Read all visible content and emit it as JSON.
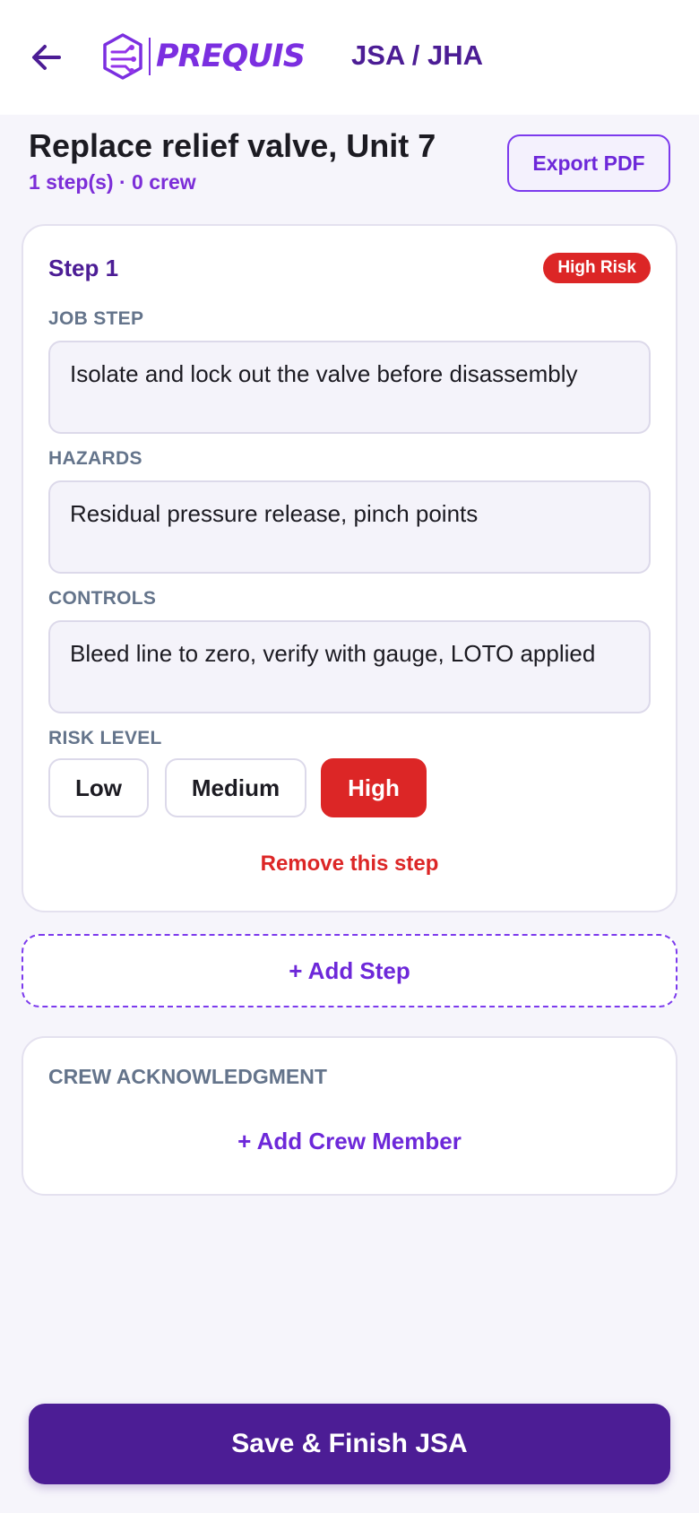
{
  "header": {
    "logo_text": "PREQUIS",
    "title": "JSA / JHA",
    "back_icon": "arrow-left-icon",
    "logo_icon": "prequis-hex-logo-icon"
  },
  "jsa": {
    "title": "Replace relief valve, Unit 7",
    "summary": "1 step(s) · 0 crew",
    "export_label": "Export PDF"
  },
  "steps": [
    {
      "label": "Step 1",
      "risk_badge": "High Risk",
      "job_step_label": "JOB STEP",
      "job_step_value": "Isolate and lock out the valve before disassembly",
      "hazards_label": "HAZARDS",
      "hazards_value": "Residual pressure release, pinch points",
      "controls_label": "CONTROLS",
      "controls_value": "Bleed line to zero, verify with gauge, LOTO applied",
      "risk_level_label": "RISK LEVEL",
      "risk_options": [
        "Low",
        "Medium",
        "High"
      ],
      "risk_selected": "High",
      "remove_label": "Remove this step"
    }
  ],
  "add_step_label": "+ Add Step",
  "crew": {
    "title": "CREW ACKNOWLEDGMENT",
    "add_label": "+ Add Crew Member"
  },
  "footer": {
    "save_label": "Save & Finish JSA"
  },
  "colors": {
    "brand_dark": "#4c1d95",
    "brand": "#6d28d9",
    "danger": "#dc2626",
    "label_gray": "#64748b",
    "background": "#f6f5fb"
  }
}
